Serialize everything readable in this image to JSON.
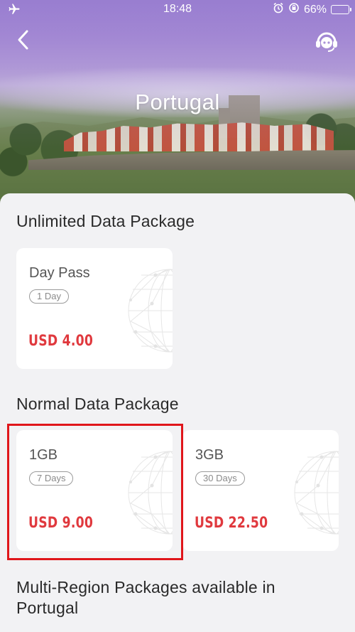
{
  "status_bar": {
    "time": "18:48",
    "battery": "66%",
    "battery_level": 0.66
  },
  "header": {
    "title": "Portugal"
  },
  "sections": {
    "unlimited": {
      "title": "Unlimited Data Package"
    },
    "normal": {
      "title": "Normal Data Package"
    },
    "multi_region": {
      "title": "Multi-Region Packages available in Portugal"
    }
  },
  "cards": [
    {
      "name": "Day Pass",
      "duration": "1 Day",
      "price": "USD 4.00"
    },
    {
      "name": "1GB",
      "duration": "7 Days",
      "price": "USD 9.00",
      "selected": true
    },
    {
      "name": "3GB",
      "duration": "30 Days",
      "price": "USD 22.50"
    }
  ],
  "colors": {
    "accent": "#e0393e",
    "highlight": "#e0161b",
    "background": "#f2f2f4"
  },
  "icons": {
    "back": "chevron-left-icon",
    "support": "customer-service-icon"
  }
}
